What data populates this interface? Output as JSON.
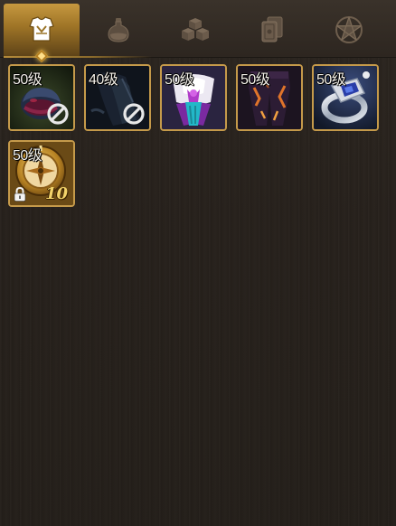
{
  "tabs": [
    {
      "icon": "armor-icon",
      "active": true
    },
    {
      "icon": "potion-icon",
      "active": false
    },
    {
      "icon": "cubes-icon",
      "active": false
    },
    {
      "icon": "cards-icon",
      "active": false
    },
    {
      "icon": "pentagram-icon",
      "active": false
    }
  ],
  "items": [
    {
      "level": "50级",
      "icon": "gloves-icon",
      "unusable": true
    },
    {
      "level": "40级",
      "icon": "cloak-icon",
      "unusable": true
    },
    {
      "level": "50级",
      "icon": "dress-icon",
      "unusable": false
    },
    {
      "level": "50级",
      "icon": "pants-icon",
      "unusable": false
    },
    {
      "level": "50级",
      "icon": "ring-icon",
      "unusable": false
    },
    {
      "level": "50级",
      "icon": "compass-icon",
      "unusable": false,
      "locked": true,
      "count": "10"
    }
  ],
  "colors": {
    "accent": "#c6983f",
    "slot_border": "#c59a4a",
    "count_text": "#f3d36a"
  }
}
